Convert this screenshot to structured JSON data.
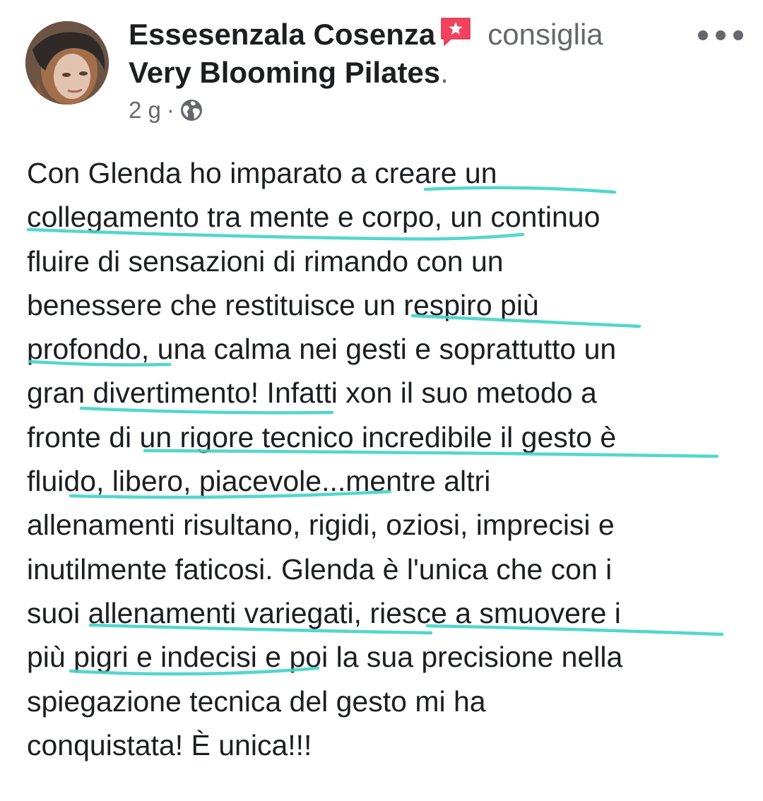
{
  "post": {
    "author": "Essesenzala Cosenza",
    "recommends_icon": "recommend-flag-icon",
    "action": "consiglia",
    "page": "Very Blooming Pilates",
    "page_suffix": ".",
    "time": "2 g",
    "separator": "·",
    "privacy_icon": "globe-icon",
    "more_icon": "more-options-icon",
    "text": "Con Glenda ho imparato a creare un\ncollegamento tra mente e corpo, un continuo\nfluire di sensazioni di rimando con un\nbenessere che restituisce un respiro più\nprofondo, una calma nei gesti e soprattutto un\ngran divertimento! Infatti xon il suo metodo a\nfronte di un rigore tecnico incredibile il gesto è\nfluido, libero, piacevole...mentre altri\nallenamenti risultano, rigidi, oziosi, imprecisi e\ninutilmente faticosi. Glenda è l'unica che con i\nsuoi allenamenti variegati, riesce a smuovere i\npiù pigri e indecisi e poi la sua precisione nella\nspiegazione tecnica del gesto mi ha\nconquistata! È unica!!!"
  },
  "colors": {
    "text": "#1c1e21",
    "secondary": "#65676b",
    "recommend_red": "#f3425f",
    "highlight": "#3fd3c6"
  }
}
